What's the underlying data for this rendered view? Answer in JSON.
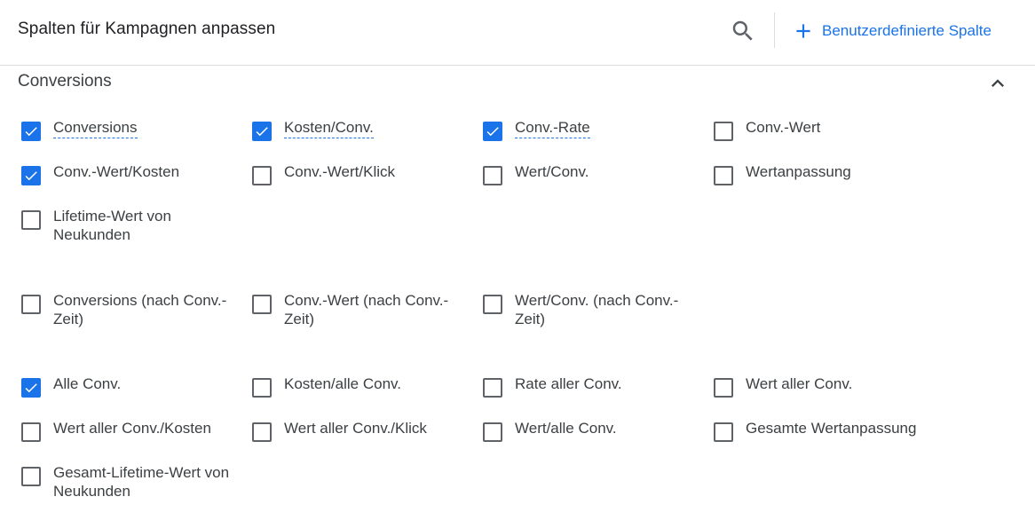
{
  "header": {
    "title": "Spalten für Kampagnen anpassen",
    "custom_column_label": "Benutzerdefinierte Spalte"
  },
  "section": {
    "title": "Conversions"
  },
  "accent_color": "#1a73e8",
  "items": [
    {
      "label": "Conversions",
      "checked": true,
      "underlined": true
    },
    {
      "label": "Kosten/Conv.",
      "checked": true,
      "underlined": true
    },
    {
      "label": "Conv.-Rate",
      "checked": true,
      "underlined": true
    },
    {
      "label": "Conv.-Wert",
      "checked": false,
      "underlined": false
    },
    {
      "label": "Conv.-Wert/Kosten",
      "checked": true,
      "underlined": false
    },
    {
      "label": "Conv.-Wert/Klick",
      "checked": false,
      "underlined": false
    },
    {
      "label": "Wert/Conv.",
      "checked": false,
      "underlined": false
    },
    {
      "label": "Wertanpassung",
      "checked": false,
      "underlined": false
    },
    {
      "label": "Lifetime-Wert von Neukunden",
      "checked": false,
      "underlined": false
    },
    {
      "label": "Conversions (nach Conv.-Zeit)",
      "checked": false,
      "underlined": false
    },
    {
      "label": "Conv.-Wert (nach Conv.-Zeit)",
      "checked": false,
      "underlined": false
    },
    {
      "label": "Wert/Conv. (nach Conv.-Zeit)",
      "checked": false,
      "underlined": false
    },
    {
      "label": "Alle Conv.",
      "checked": true,
      "underlined": false
    },
    {
      "label": "Kosten/alle Conv.",
      "checked": false,
      "underlined": false
    },
    {
      "label": "Rate aller Conv.",
      "checked": false,
      "underlined": false
    },
    {
      "label": "Wert aller Conv.",
      "checked": false,
      "underlined": false
    },
    {
      "label": "Wert aller Conv./Kosten",
      "checked": false,
      "underlined": false
    },
    {
      "label": "Wert aller Conv./Klick",
      "checked": false,
      "underlined": false
    },
    {
      "label": "Wert/alle Conv.",
      "checked": false,
      "underlined": false
    },
    {
      "label": "Gesamte Wertanpassung",
      "checked": false,
      "underlined": false
    },
    {
      "label": "Gesamt-Lifetime-Wert von Neukunden",
      "checked": false,
      "underlined": false
    }
  ]
}
